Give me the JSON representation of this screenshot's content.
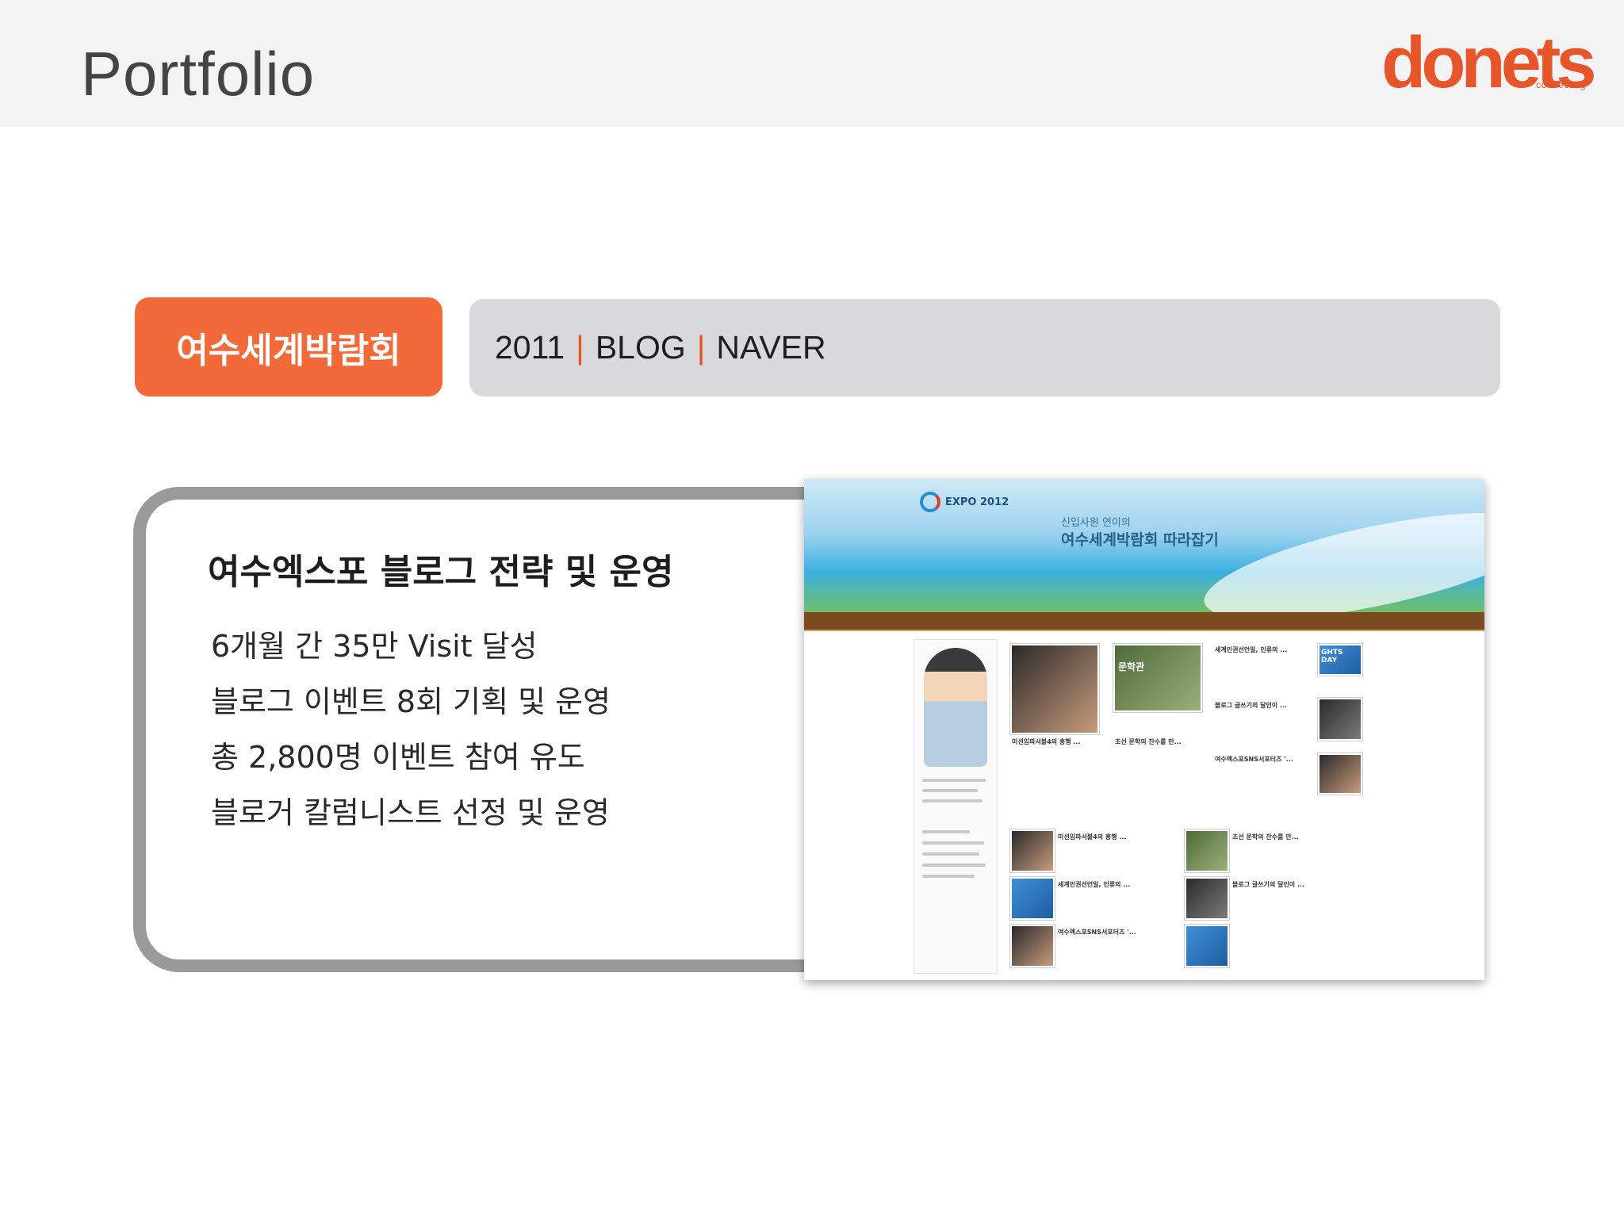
{
  "header": {
    "title": "Portfolio",
    "logo_text": "donets",
    "logo_tagline": "connecting"
  },
  "project": {
    "name": "여수세계박람회",
    "year": "2011",
    "separator": "|",
    "channel": "BLOG",
    "platform": "NAVER"
  },
  "detail": {
    "title": "여수엑스포 블로그 전략 및 운영",
    "bullets": [
      "6개월 간 35만 Visit 달성",
      "블로그 이벤트 8회 기획 및 운영",
      "총 2,800명 이벤트 참여 유도",
      "블로거 칼럼니스트 선정 및 운영"
    ]
  },
  "screenshot": {
    "logo": "EXPO 2012",
    "banner_sub": "신입사원 연이의",
    "banner_title": "여수세계박람회 따라잡기",
    "thumb_word_1": "문학관",
    "thumb_word_2": "GHTS DAY",
    "captions": [
      "미션임파서블4의 흥행 ...",
      "조선 문학의 잔수를 만...",
      "세계인권선언일, 인류의 ...",
      "블로그 글쓰기의 달인이 ...",
      "여수엑스포SNS서포터즈 '..."
    ]
  },
  "colors": {
    "accent": "#f26a3a",
    "bar_gray": "#d9d9db",
    "card_border": "#9a9a9a",
    "header_bg": "#f3f3f3"
  }
}
